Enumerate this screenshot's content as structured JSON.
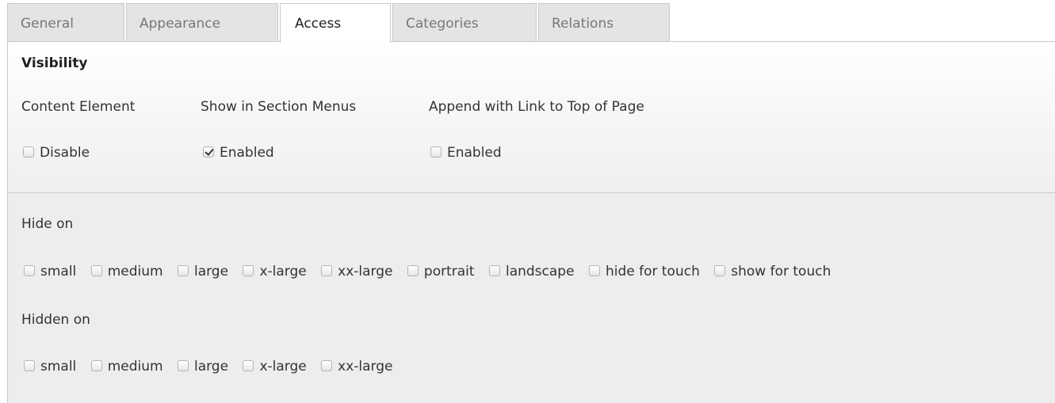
{
  "tabs": [
    {
      "label": "General"
    },
    {
      "label": "Appearance"
    },
    {
      "label": "Access",
      "active": true
    },
    {
      "label": "Categories"
    },
    {
      "label": "Relations"
    }
  ],
  "visibility": {
    "header": "Visibility",
    "content_element": {
      "label": "Content Element",
      "option": "Disable",
      "checked": false
    },
    "section_menus": {
      "label": "Show in Section Menus",
      "option": "Enabled",
      "checked": true
    },
    "top_link": {
      "label": "Append with Link to Top of Page",
      "option": "Enabled",
      "checked": false
    }
  },
  "hide_on": {
    "label": "Hide on",
    "options": [
      "small",
      "medium",
      "large",
      "x-large",
      "xx-large",
      "portrait",
      "landscape",
      "hide for touch",
      "show for touch"
    ]
  },
  "hidden_on": {
    "label": "Hidden on",
    "options": [
      "small",
      "medium",
      "large",
      "x-large",
      "xx-large"
    ]
  }
}
